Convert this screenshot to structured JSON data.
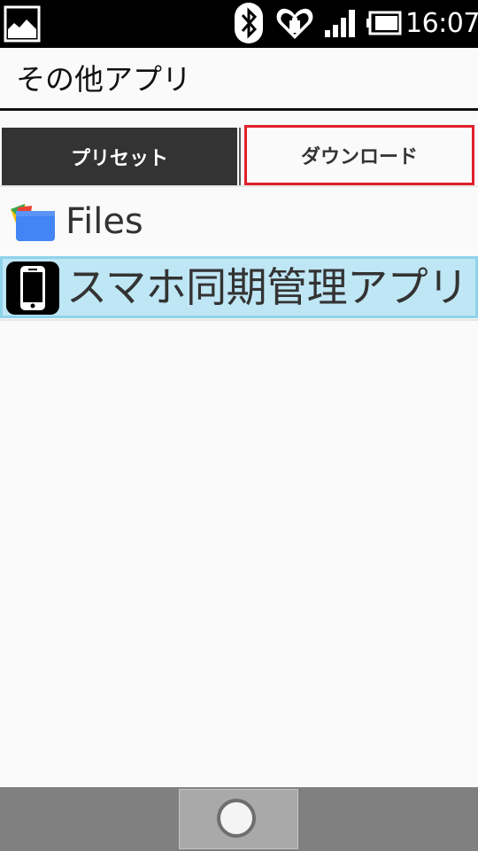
{
  "status_bar": {
    "time": "16:07",
    "icons": [
      "gallery-icon",
      "bluetooth-icon",
      "health-heart-icon",
      "signal-icon",
      "battery-icon"
    ]
  },
  "header": {
    "title": "その他アプリ"
  },
  "tabs": [
    {
      "label": "プリセット",
      "selected": true
    },
    {
      "label": "ダウンロード",
      "selected": false
    }
  ],
  "apps": [
    {
      "label": "Files",
      "icon": "files-app-icon"
    },
    {
      "label": "スマホ同期管理アプリ",
      "icon": "smartphone-icon",
      "highlighted": true
    }
  ],
  "colors": {
    "status_bar_bg": "#000000",
    "tab_selected_bg": "#333333",
    "highlight_border": "#e0202a",
    "list_highlight_bg": "#bfe6f4",
    "nav_bar_bg": "#808080"
  }
}
